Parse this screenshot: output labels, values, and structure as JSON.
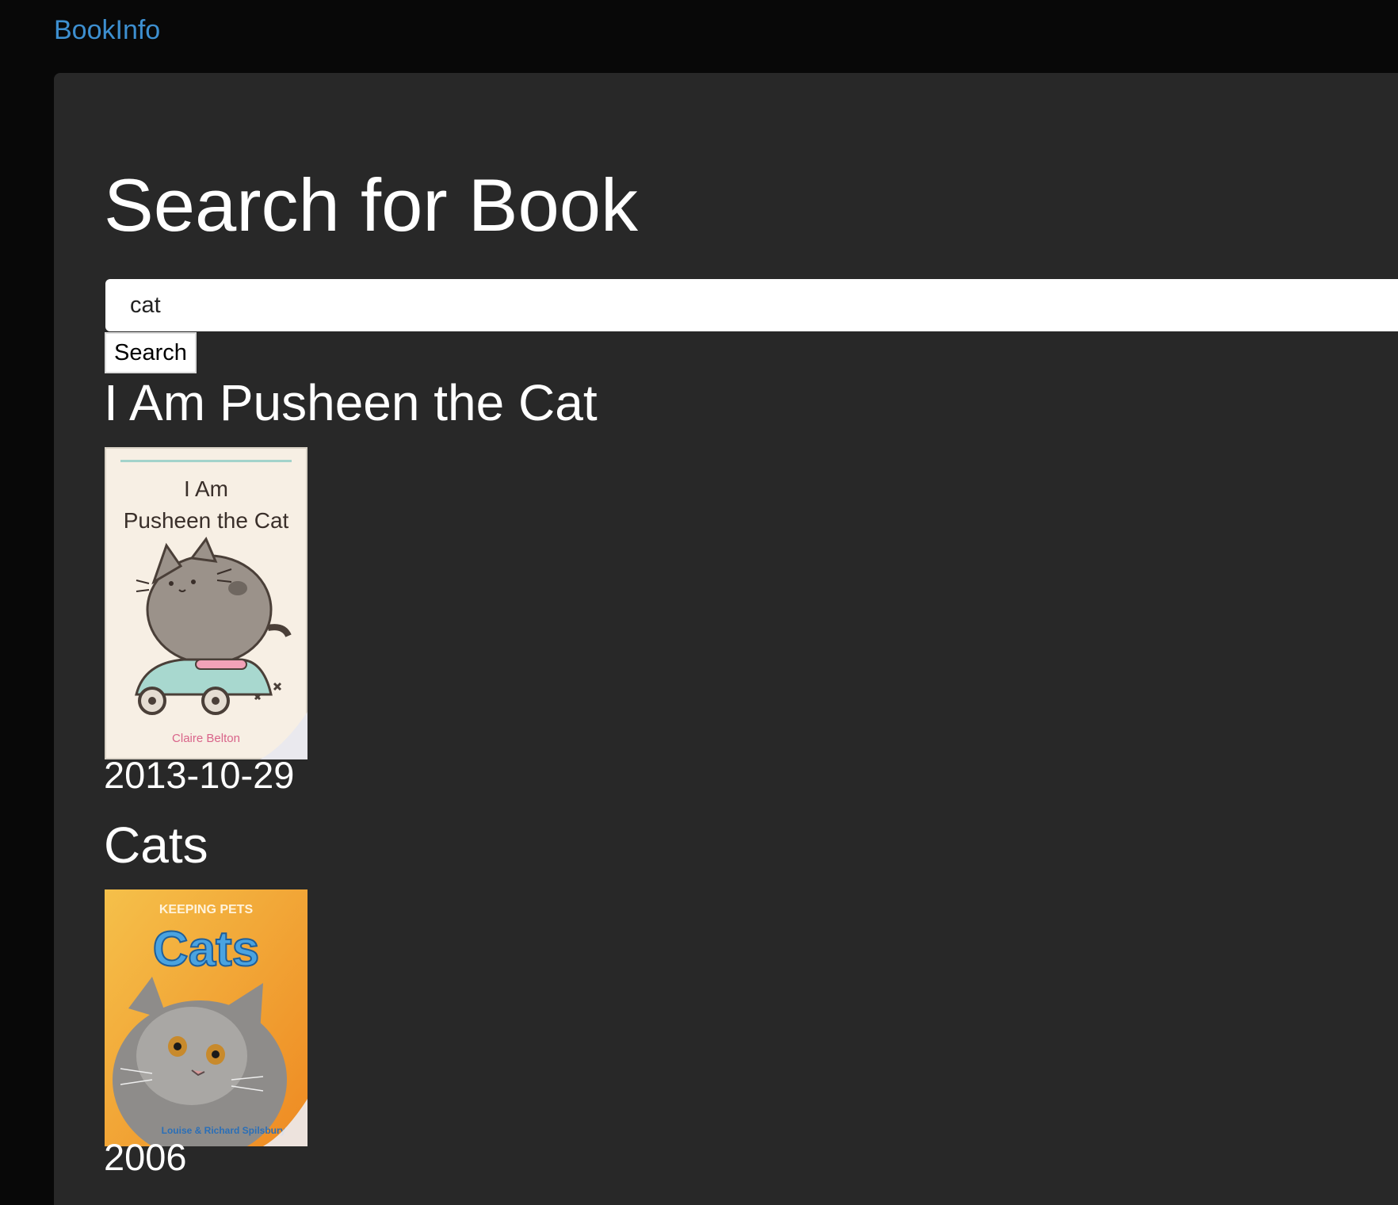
{
  "navbar": {
    "brand": "BookInfo"
  },
  "page": {
    "title": "Search for Book"
  },
  "search": {
    "value": "cat",
    "button_label": "Search"
  },
  "results": [
    {
      "title": "I Am Pusheen the Cat",
      "date": "2013-10-29",
      "cover": {
        "heading_line1": "I Am",
        "heading_line2": "Pusheen the Cat",
        "author": "Claire Belton",
        "background": "#f7efe4",
        "scooter_color": "#a8d8cf",
        "author_color": "#d9648a"
      }
    },
    {
      "title": "Cats",
      "date": "2006",
      "cover": {
        "series": "KEEPING PETS",
        "heading": "Cats",
        "author": "Louise & Richard Spilsbury",
        "background": "#f0a030",
        "heading_color": "#4aa3e0"
      }
    }
  ]
}
